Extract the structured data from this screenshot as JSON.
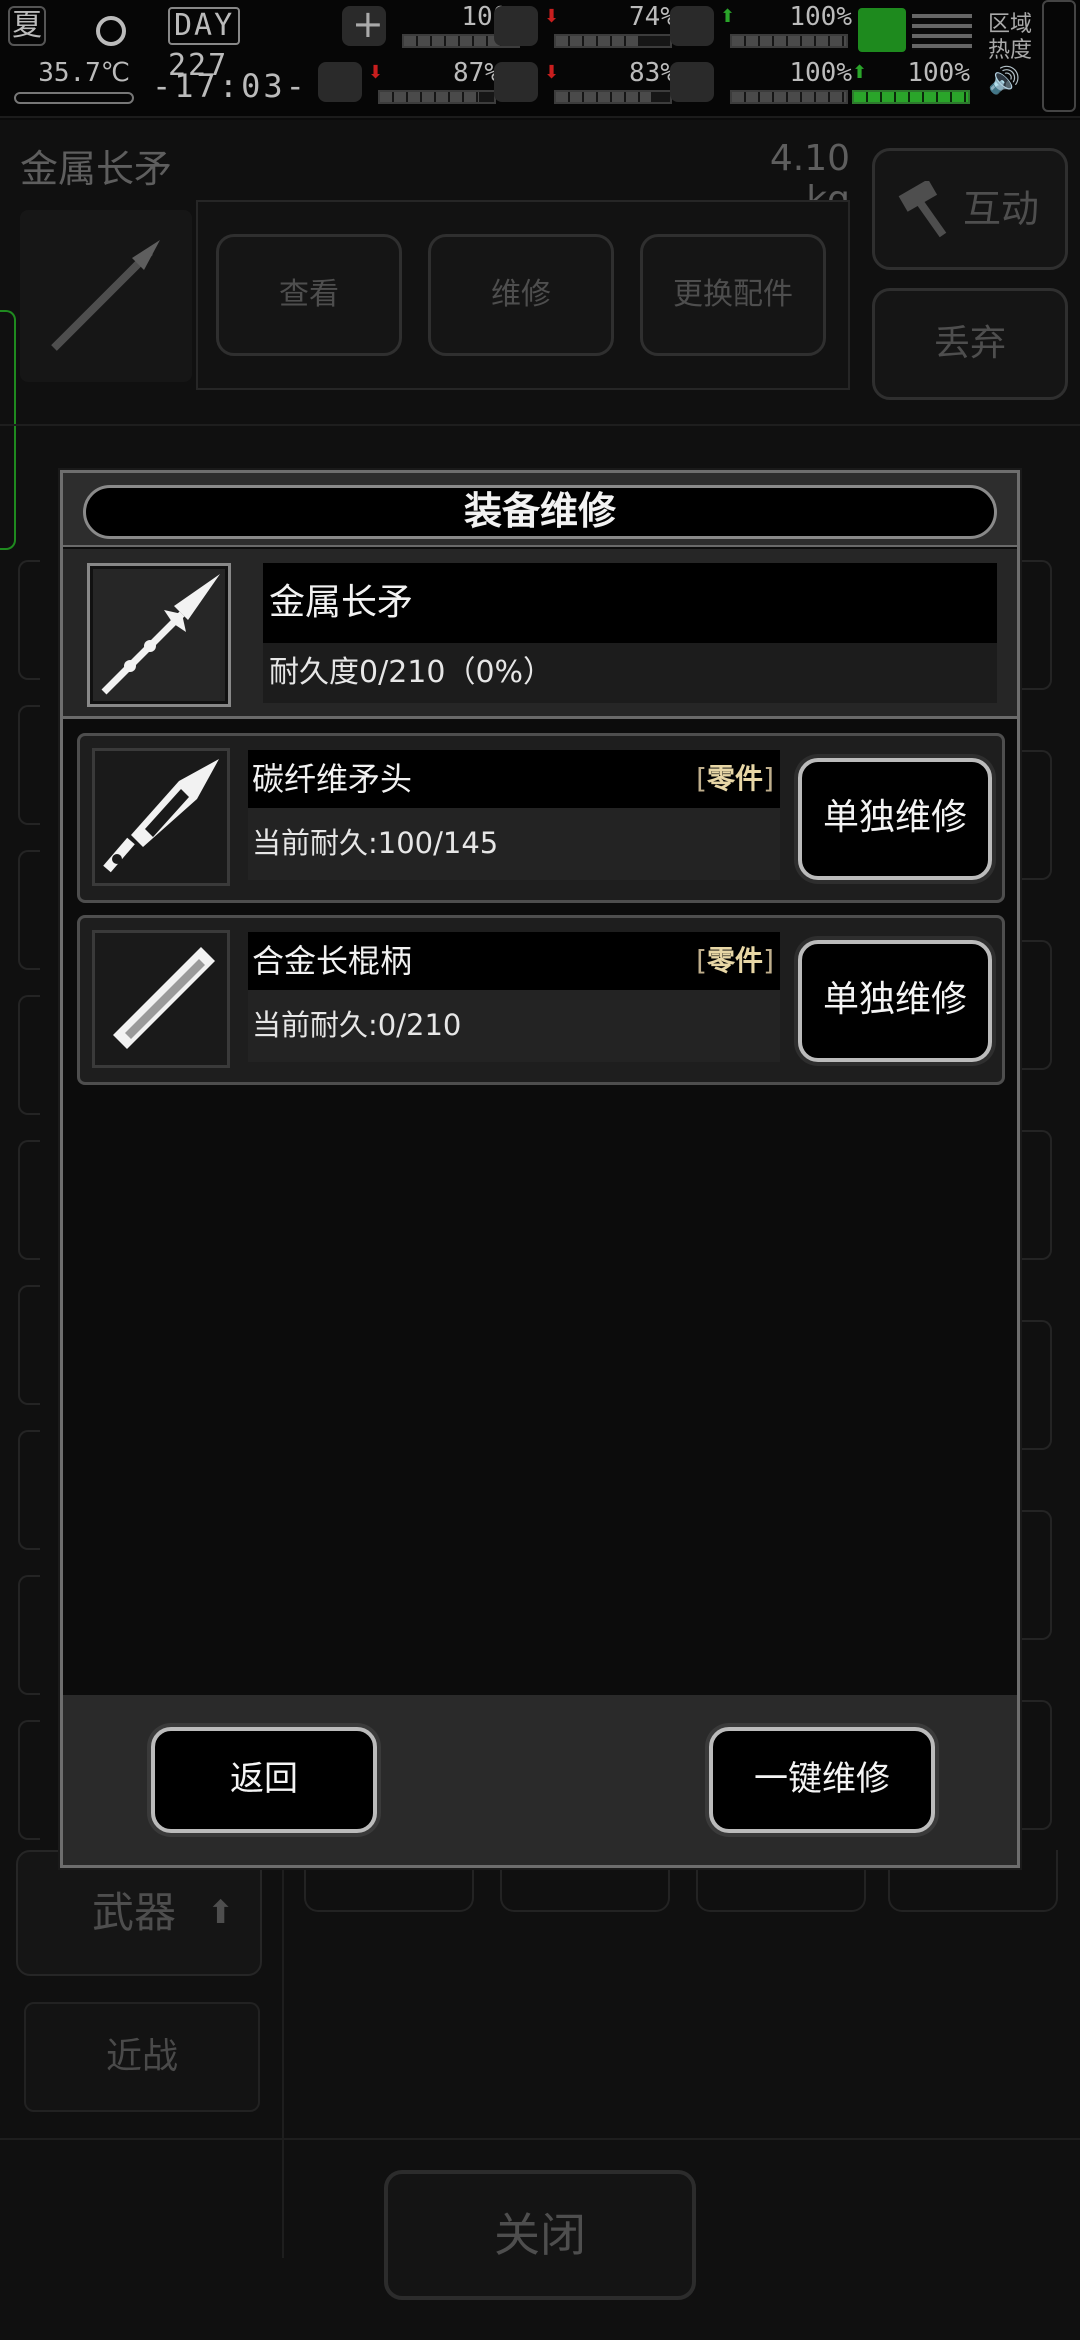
{
  "hud": {
    "season": "夏",
    "day_label": "DAY",
    "day_number": "227",
    "temperature": "35.7℃",
    "time": "-17:03-",
    "stats": [
      {
        "icon": "medkit-icon",
        "value": "100%",
        "arrow": "",
        "level": 1.0
      },
      {
        "icon": "stomach-icon",
        "value": "74%",
        "arrow": "down",
        "level": 0.74
      },
      {
        "icon": "lungs-icon",
        "value": "100%",
        "arrow": "up",
        "level": 1.0
      },
      {
        "icon": "brain-icon",
        "value": "87%",
        "arrow": "down",
        "level": 0.87
      },
      {
        "icon": "water-drop-icon",
        "value": "83%",
        "arrow": "down",
        "level": 0.83
      },
      {
        "icon": "heart-icon",
        "value": "100%",
        "arrow": "",
        "level": 1.0
      },
      {
        "icon": "stamina-icon",
        "value": "100%",
        "arrow": "up",
        "level": 1.0
      }
    ],
    "region_label": "区域热度",
    "colors": {
      "accent_green": "#1e8a1e",
      "arrow_red": "#c81e1e",
      "arrow_green": "#2aa52a"
    }
  },
  "background": {
    "item_name": "金属长矛",
    "item_weight": "4.10 kg",
    "buttons": {
      "view": "查看",
      "repair": "维修",
      "swap_parts": "更换配件",
      "interact": "互动",
      "drop": "丢弃"
    },
    "category": "武器",
    "subcategory": "近战",
    "close": "关闭"
  },
  "dialog": {
    "title": "装备维修",
    "item": {
      "name": "金属长矛",
      "durability": "耐久度0/210（0%）"
    },
    "parts": [
      {
        "name": "碳纤维矛头",
        "tag_open": "[",
        "tag": "零件",
        "tag_close": "]",
        "durability": "当前耐久:100/145",
        "button": "单独维修"
      },
      {
        "name": "合金长棍柄",
        "tag_open": "[",
        "tag": "零件",
        "tag_close": "]",
        "durability": "当前耐久:0/210",
        "button": "单独维修"
      }
    ],
    "back_button": "返回",
    "repair_all_button": "一键维修"
  }
}
